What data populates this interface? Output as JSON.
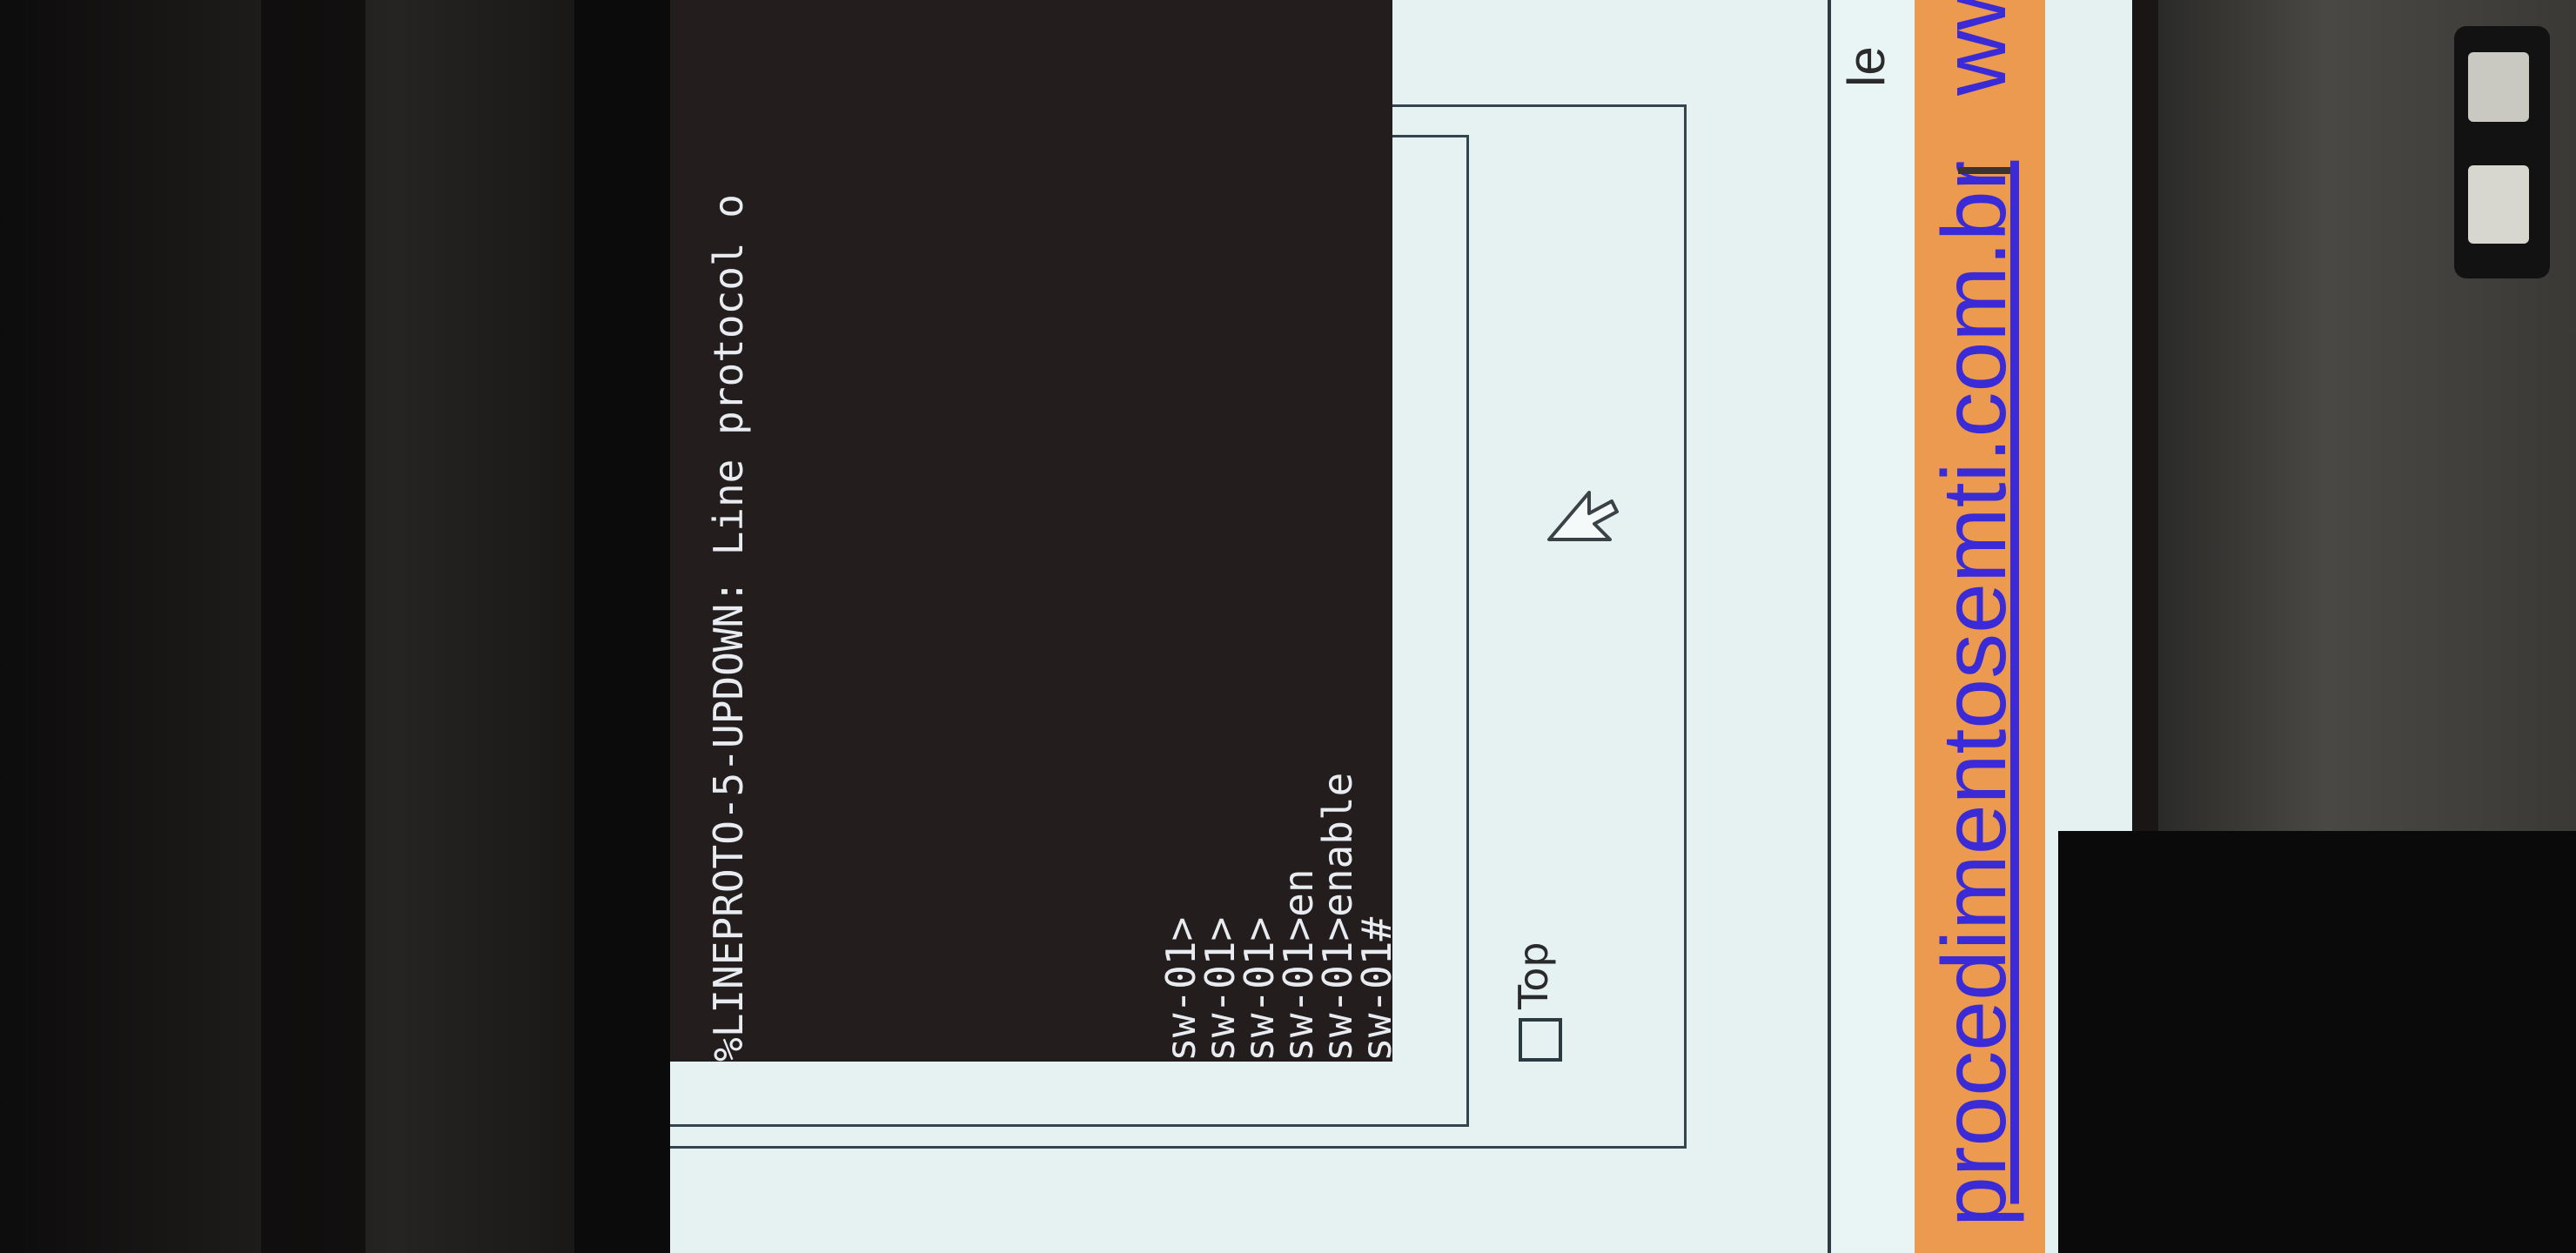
{
  "terminal": {
    "syslog_line": "%LINEPROTO-5-UPDOWN: Line protocol o",
    "lines": [
      "sw-01>",
      "sw-01>",
      "sw-01>",
      "sw-01>en",
      "sw-01>enable",
      "sw-01#"
    ]
  },
  "window": {
    "top_checkbox_label": "Top"
  },
  "banner": {
    "url_text": "procedimentosemti.com.br",
    "url_text_2": "ww",
    "side_letters": "le"
  },
  "colors": {
    "terminal_bg": "#231d1d",
    "terminal_fg": "#e8ecf0",
    "banner_orange": "#eb9a4f",
    "link_blue": "#3b2bd6",
    "window_bg": "#e6f2f1"
  }
}
